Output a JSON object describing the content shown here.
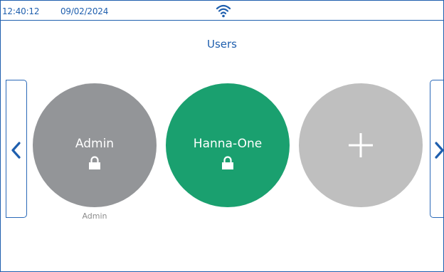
{
  "status": {
    "time": "12:40:12",
    "date": "09/02/2024",
    "wifi_icon": "wifi-icon"
  },
  "page": {
    "title": "Users"
  },
  "users": [
    {
      "name": "Admin",
      "locked": true,
      "color": "#939598",
      "caption": "Admin"
    },
    {
      "name": "Hanna-One",
      "locked": true,
      "color": "#1aa06f"
    }
  ],
  "add_user": {
    "icon": "plus-icon",
    "color": "#bfbfbf"
  },
  "nav": {
    "prev_icon": "chevron-left-icon",
    "next_icon": "chevron-right-icon"
  },
  "colors": {
    "accent": "#1f5fae"
  }
}
